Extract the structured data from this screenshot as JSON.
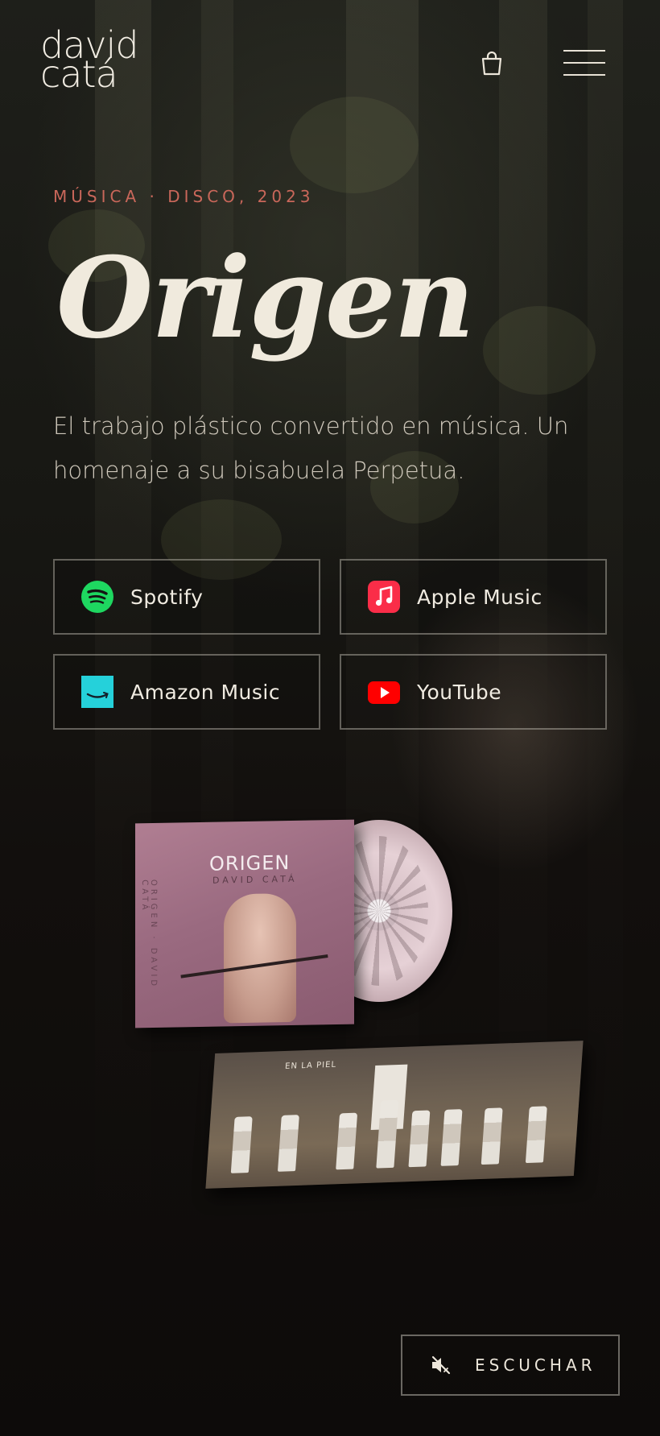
{
  "header": {
    "logo_line1": "david",
    "logo_line2": "catá",
    "cart_icon": "shopping-bag-icon",
    "menu_icon": "hamburger-menu-icon"
  },
  "hero": {
    "eyebrow": "MÚSICA · DISCO, 2023",
    "title": "Origen",
    "description": "El trabajo plástico convertido en música. Un homenaje a su bisabuela Perpetua."
  },
  "streaming": [
    {
      "label": "Spotify",
      "icon": "spotify-icon",
      "color": "#1ed760"
    },
    {
      "label": "Apple Music",
      "icon": "apple-music-icon",
      "color": "#fa2d48"
    },
    {
      "label": "Amazon Music",
      "icon": "amazon-music-icon",
      "color": "#25d1da"
    },
    {
      "label": "YouTube",
      "icon": "youtube-icon",
      "color": "#ff0000"
    }
  ],
  "album": {
    "cover_title": "ORIGEN",
    "cover_artist": "DAVID CATÁ",
    "spine_text": "ORIGEN · DAVID CATÁ",
    "booklet_heading": "EN LA PIEL"
  },
  "listen_button": {
    "label": "ESCUCHAR",
    "icon": "speaker-muted-icon"
  },
  "colors": {
    "accent": "#c9675a",
    "text": "#ece5d8"
  }
}
